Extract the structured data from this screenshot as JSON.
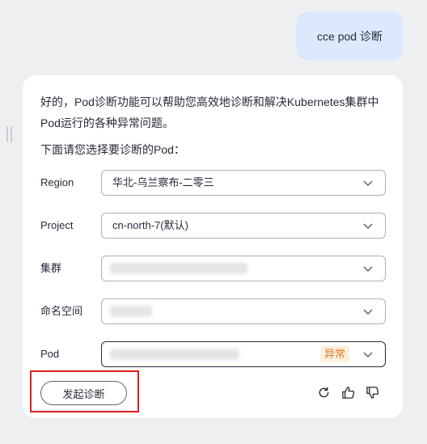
{
  "user_message": "cce pod 诊断",
  "bot": {
    "intro": "好的，Pod诊断功能可以帮助您高效地诊断和解决Kubernetes集群中Pod运行的各种异常问题。",
    "prompt": "下面请您选择要诊断的Pod："
  },
  "form": {
    "region": {
      "label": "Region",
      "value": "华北-乌兰察布-二零三"
    },
    "project": {
      "label": "Project",
      "value": "cn-north-7(默认)"
    },
    "cluster": {
      "label": "集群",
      "value": ""
    },
    "namespace": {
      "label": "命名空间",
      "value": ""
    },
    "pod": {
      "label": "Pod",
      "value": "",
      "status": "异常",
      "status_color": "#e37d29"
    }
  },
  "actions": {
    "diagnose_label": "发起诊断"
  },
  "icons": [
    "drag-handle-icon",
    "chevron-down-icon",
    "refresh-icon",
    "thumbs-up-icon",
    "thumbs-down-icon"
  ],
  "colors": {
    "user_bubble": "#dce9fd",
    "highlight_border": "#e01f1f",
    "warning_tag_bg": "#fdf0dc"
  }
}
